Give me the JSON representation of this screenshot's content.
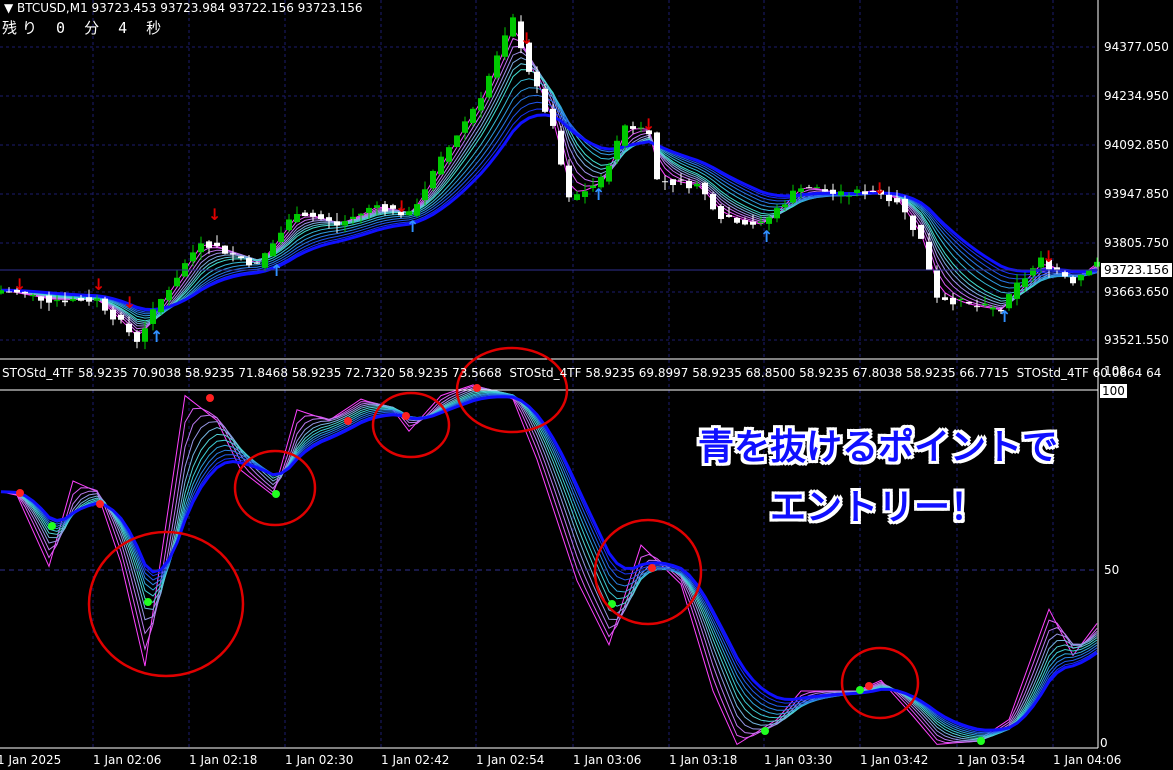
{
  "header": {
    "symbol_text": "▼ BTCUSD,M1  93723.453 93723.984 93722.156 93723.156",
    "remaining_text": "残り 0 分 4 秒"
  },
  "price_axis": {
    "labels": [
      "94377.050",
      "94234.950",
      "94092.850",
      "93947.850",
      "93805.750",
      "93663.650",
      "93521.550"
    ],
    "current_price": "93723.156"
  },
  "indicator": {
    "label_text": "STOStd_4TF 58.9235 70.9038 58.9235 71.8468 58.9235 72.7320 58.9235 73.5668  STOStd_4TF 58.9235 69.8997 58.9235 68.8500 58.9235 67.8038 58.9235 66.7715  STOStd_4TF 60.0664 64",
    "axis_labels": {
      "top": "108",
      "max": "100",
      "mid": "50",
      "min": "0"
    }
  },
  "time_axis": [
    "1 Jan 2025",
    "1 Jan 02:06",
    "1 Jan 02:18",
    "1 Jan 02:30",
    "1 Jan 02:42",
    "1 Jan 02:54",
    "1 Jan 03:06",
    "1 Jan 03:18",
    "1 Jan 03:30",
    "1 Jan 03:42",
    "1 Jan 03:54",
    "1 Jan 04:06"
  ],
  "annotation": {
    "line1": "青を抜けるポイントで",
    "line2": "エントリー！"
  },
  "colors": {
    "bull": "#00c800",
    "bear": "#ffffff",
    "grid": "#1c1c6e",
    "annot_circle": "#e00000",
    "ribbon_fast": "#ff40ff",
    "ribbon_mid": "#40e0d0",
    "ribbon_slow": "#1010ff"
  },
  "chart_data": [
    {
      "type": "candlestick",
      "title": "BTCUSD,M1",
      "x_unit": "minute index",
      "price_path": [
        [
          0,
          93667
        ],
        [
          6,
          93640
        ],
        [
          12,
          93640
        ],
        [
          17,
          93522
        ],
        [
          20,
          93640
        ],
        [
          25,
          93813
        ],
        [
          32,
          93740
        ],
        [
          37,
          93900
        ],
        [
          42,
          93857
        ],
        [
          47,
          93915
        ],
        [
          51,
          93886
        ],
        [
          55,
          94047
        ],
        [
          60,
          94237
        ],
        [
          64,
          94456
        ],
        [
          66,
          94310
        ],
        [
          69,
          94135
        ],
        [
          71,
          93930
        ],
        [
          75,
          93988
        ],
        [
          78,
          94149
        ],
        [
          81,
          94135
        ],
        [
          82,
          93988
        ],
        [
          87,
          93974
        ],
        [
          90,
          93886
        ],
        [
          95,
          93857
        ],
        [
          100,
          93974
        ],
        [
          105,
          93944
        ],
        [
          109,
          93959
        ],
        [
          112,
          93930
        ],
        [
          115,
          93813
        ],
        [
          117,
          93652
        ],
        [
          121,
          93623
        ],
        [
          125,
          93608
        ],
        [
          127,
          93681
        ],
        [
          130,
          93754
        ],
        [
          134,
          93696
        ],
        [
          137,
          93754
        ]
      ],
      "ylim": [
        93480,
        94480
      ]
    },
    {
      "type": "line",
      "title": "STOStd_4TF",
      "x_unit": "minute index",
      "stoch_path": [
        [
          0,
          72
        ],
        [
          2,
          71
        ],
        [
          6,
          51
        ],
        [
          9,
          75
        ],
        [
          12,
          72
        ],
        [
          15,
          52
        ],
        [
          18,
          23
        ],
        [
          23,
          99
        ],
        [
          27,
          92
        ],
        [
          30,
          78
        ],
        [
          34,
          71
        ],
        [
          37,
          95
        ],
        [
          41,
          92
        ],
        [
          45,
          98
        ],
        [
          49,
          95
        ],
        [
          51,
          89
        ],
        [
          55,
          99
        ],
        [
          59,
          102
        ],
        [
          64,
          98
        ],
        [
          67,
          81
        ],
        [
          72,
          47
        ],
        [
          76,
          29
        ],
        [
          80,
          57
        ],
        [
          85,
          46
        ],
        [
          89,
          16
        ],
        [
          92,
          1
        ],
        [
          97,
          8
        ],
        [
          100,
          16
        ],
        [
          107,
          16
        ],
        [
          110,
          19
        ],
        [
          114,
          9
        ],
        [
          117,
          1
        ],
        [
          122,
          2
        ],
        [
          126,
          8
        ],
        [
          131,
          39
        ],
        [
          134,
          26
        ],
        [
          137,
          35
        ]
      ],
      "ylim": [
        0,
        108
      ],
      "levels": [
        50
      ]
    }
  ]
}
